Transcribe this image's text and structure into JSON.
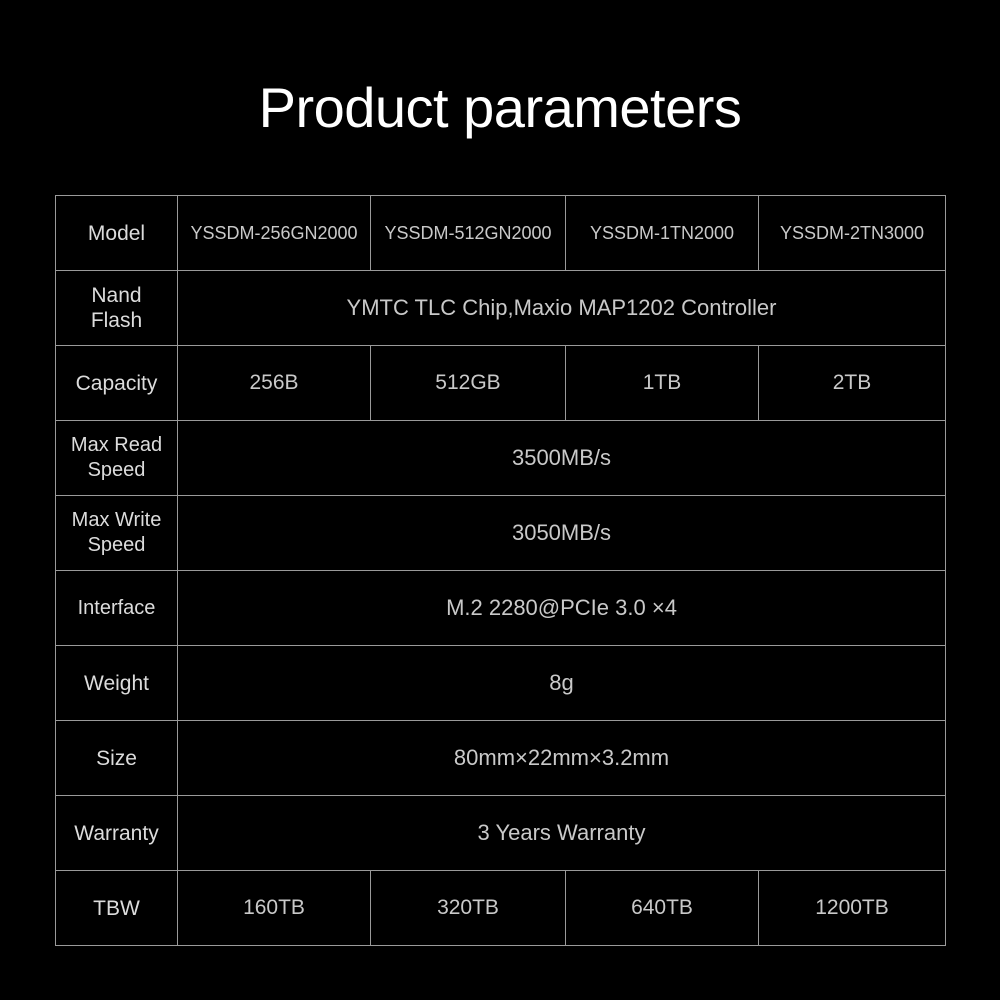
{
  "page": {
    "title": "Product parameters",
    "background_color": "#000000",
    "title_color": "#ffffff",
    "border_color": "#9a9a9a",
    "label_color": "#dcdcdc",
    "value_color": "#c9c9c9"
  },
  "table": {
    "rows": [
      {
        "label": "Model",
        "label_line1": "Model",
        "label_line2": "",
        "type": "split",
        "values": [
          "YSSDM-256GN2000",
          "YSSDM-512GN2000",
          "YSSDM-1TN2000",
          "YSSDM-2TN3000"
        ]
      },
      {
        "label": "Nand Flash",
        "label_line1": "Nand",
        "label_line2": "Flash",
        "type": "merged",
        "value": "YMTC TLC Chip,Maxio MAP1202 Controller"
      },
      {
        "label": "Capacity",
        "label_line1": "Capacity",
        "label_line2": "",
        "type": "split",
        "values": [
          "256B",
          "512GB",
          "1TB",
          "2TB"
        ]
      },
      {
        "label": "Max Read Speed",
        "label_line1": "Max Read",
        "label_line2": "Speed",
        "type": "merged",
        "value": "3500MB/s"
      },
      {
        "label": "Max Write Speed",
        "label_line1": "Max Write",
        "label_line2": "Speed",
        "type": "merged",
        "value": "3050MB/s"
      },
      {
        "label": "Interface",
        "label_line1": "Interface",
        "label_line2": "",
        "type": "merged",
        "value": "M.2 2280@PCIe 3.0 ×4"
      },
      {
        "label": "Weight",
        "label_line1": "Weight",
        "label_line2": "",
        "type": "merged",
        "value": "8g"
      },
      {
        "label": "Size",
        "label_line1": "Size",
        "label_line2": "",
        "type": "merged",
        "value": "80mm×22mm×3.2mm"
      },
      {
        "label": "Warranty",
        "label_line1": "Warranty",
        "label_line2": "",
        "type": "merged",
        "value": "3 Years Warranty"
      },
      {
        "label": "TBW",
        "label_line1": "TBW",
        "label_line2": "",
        "type": "split",
        "values": [
          "160TB",
          "320TB",
          "640TB",
          "1200TB"
        ]
      }
    ]
  }
}
